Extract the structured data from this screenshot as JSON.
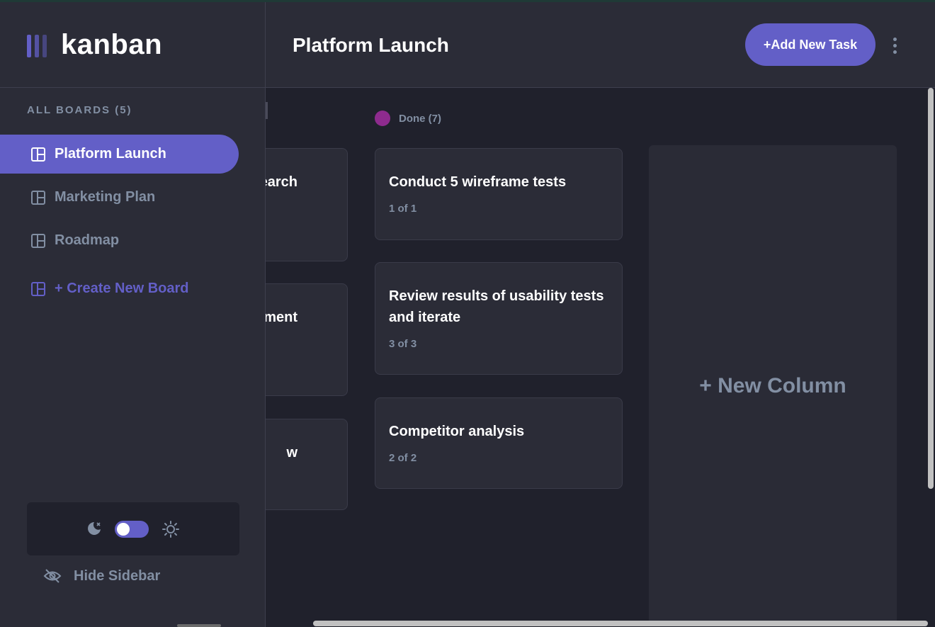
{
  "header": {
    "logo_text": "kanban",
    "board_title": "Platform Launch",
    "add_task_label": "+Add New Task",
    "menu_icon": "kebab-menu-icon"
  },
  "sidebar": {
    "all_boards_label": "ALL BOARDS (5)",
    "boards": [
      {
        "label": "Platform Launch",
        "active": true
      },
      {
        "label": "Marketing Plan",
        "active": false
      },
      {
        "label": "Roadmap",
        "active": false
      }
    ],
    "create_label": "+ Create New Board",
    "theme": {
      "moon_icon": "moon-icon",
      "sun_icon": "sun-icon",
      "toggle_state": "dark"
    },
    "hide_label": "Hide Sidebar"
  },
  "board": {
    "partial_cards": [
      {
        "title_visible": "earch"
      },
      {
        "title_visible": "ment"
      },
      {
        "title_visible": "w"
      }
    ],
    "done_column": {
      "header": "Done (7)",
      "color": "#8e2b8e",
      "cards": [
        {
          "title": "Conduct 5 wireframe tests",
          "subtasks": "1 of 1"
        },
        {
          "title": "Review results of usability tests and iterate",
          "subtasks": "3 of 3"
        },
        {
          "title": "Competitor analysis",
          "subtasks": "2 of 2"
        }
      ]
    },
    "new_column_label": "+ New Column"
  },
  "colors": {
    "accent": "#635fc7",
    "panel": "#2b2c37",
    "background": "#20212c",
    "muted_text": "#828fa3"
  }
}
